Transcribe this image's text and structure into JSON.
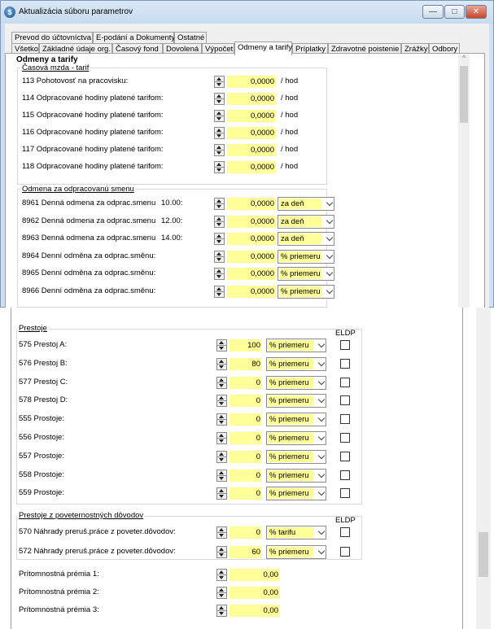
{
  "window": {
    "title": "Aktualizácia súboru parametrov",
    "icon": "app-logo-icon"
  },
  "tabs_row1": [
    "Prevod do účtovníctva",
    "E-podání a Dokumenty",
    "Ostatné"
  ],
  "tabs_row2": [
    "Všetko",
    "Základné údaje org.",
    "Časový fond",
    "Dovolená",
    "Výpočet",
    "Odmeny a tarify",
    "Príplatky",
    "Zdravotné poistenie",
    "Zrážky",
    "Odbory"
  ],
  "active_tab": "Odmeny a tarify",
  "section_title": "Odmeny a tarify",
  "group_casova": {
    "title": "Časová mzda - tarif",
    "rows": [
      {
        "label": "113 Pohotovosť na pracovisku:",
        "value": "0,0000",
        "unit": "/ hod"
      },
      {
        "label": "114 Odpracované hodiny platené tarifom:",
        "value": "0,0000",
        "unit": "/ hod"
      },
      {
        "label": "115 Odpracované hodiny platené tarifom:",
        "value": "0,0000",
        "unit": "/ hod"
      },
      {
        "label": "116 Odpracované hodiny platené tarifom:",
        "value": "0,0000",
        "unit": "/ hod"
      },
      {
        "label": "117 Odpracované hodiny platené tarifom:",
        "value": "0,0000",
        "unit": "/ hod"
      },
      {
        "label": "118 Odpracované hodiny platené tarifom:",
        "value": "0,0000",
        "unit": "/ hod"
      }
    ]
  },
  "group_smena": {
    "title": "Odmena za odpracovanú smenu",
    "rows": [
      {
        "label": "8961 Denná odmena za odprac.smenu",
        "time": "10.00:",
        "value": "0,0000",
        "select": "za deň"
      },
      {
        "label": "8962 Denná odmena za odprac.smenu",
        "time": "12.00:",
        "value": "0,0000",
        "select": "za deň"
      },
      {
        "label": "8963 Denná odmena za odprac.smenu",
        "time": "14.00:",
        "value": "0,0000",
        "select": "za deň"
      },
      {
        "label": "8964 Denní odměna za odprac.směnu:",
        "time": "",
        "value": "0,0000",
        "select": "% priemeru"
      },
      {
        "label": "8965 Denní odměna za odprac.směnu:",
        "time": "",
        "value": "0,0000",
        "select": "% priemeru"
      },
      {
        "label": "8966 Denní odměna za odprac.směnu:",
        "time": "",
        "value": "0,0000",
        "select": "% priemeru"
      }
    ]
  },
  "group_prestoje": {
    "title": "Prestoje",
    "eldp_label": "ELDP",
    "rows": [
      {
        "label": "575 Prestoj A:",
        "value": "100",
        "select": "% priemeru"
      },
      {
        "label": "576 Prestoj B:",
        "value": "80",
        "select": "% priemeru"
      },
      {
        "label": "577 Prestoj C:",
        "value": "0",
        "select": "% priemeru"
      },
      {
        "label": "578 Prestoj D:",
        "value": "0",
        "select": "% priemeru"
      },
      {
        "label": "555 Prostoje:",
        "value": "0",
        "select": "% priemeru"
      },
      {
        "label": "556 Prostoje:",
        "value": "0",
        "select": "% priemeru"
      },
      {
        "label": "557 Prostoje:",
        "value": "0",
        "select": "% priemeru"
      },
      {
        "label": "558 Prostoje:",
        "value": "0",
        "select": "% priemeru"
      },
      {
        "label": "559 Prostoje:",
        "value": "0",
        "select": "% priemeru"
      }
    ]
  },
  "group_poveternostne": {
    "title": "Prestoje z poveternostných dôvodov",
    "eldp_label": "ELDP",
    "rows": [
      {
        "label": "570 Náhrady preruš.práce z poveter.dôvodov:",
        "value": "0",
        "select": "% tarifu"
      },
      {
        "label": "572 Náhrady preruš.práce z poveter.dôvodov:",
        "value": "60",
        "select": "% priemeru"
      }
    ]
  },
  "premie": [
    {
      "label": "Prítomnostná prémia 1:",
      "value": "0,00"
    },
    {
      "label": "Prítomnostná prémia 2:",
      "value": "0,00"
    },
    {
      "label": "Prítomnostná prémia 3:",
      "value": "0,00"
    }
  ],
  "colors": {
    "input_bg": "#ffff99",
    "title_bar": "#cfe0f2",
    "close_button": "#c7452e"
  }
}
